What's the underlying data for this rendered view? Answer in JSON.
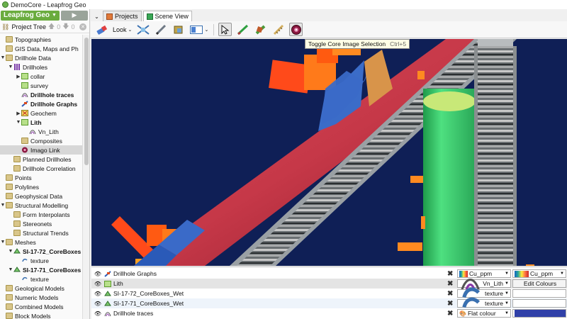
{
  "window": {
    "title": "DemoCore - Leapfrog Geo"
  },
  "app": {
    "menu_label": "Leapfrog Geo",
    "play_label": "▶"
  },
  "tree_header": {
    "label": "Project Tree",
    "count_up": "0",
    "count_down": "0"
  },
  "tree": [
    {
      "label": "Topographies",
      "arrow": "",
      "level": 0,
      "icon": "folder-icon",
      "bold": false,
      "selected": false
    },
    {
      "label": "GIS Data, Maps and Ph",
      "arrow": "",
      "level": 0,
      "icon": "folder-icon",
      "bold": false,
      "selected": false
    },
    {
      "label": "Drillhole Data",
      "arrow": "▼",
      "level": 0,
      "icon": "folder-icon",
      "bold": false,
      "selected": false
    },
    {
      "label": "Drillholes",
      "arrow": "▼",
      "level": 1,
      "icon": "drillholes-icon",
      "bold": false,
      "selected": false
    },
    {
      "label": "collar",
      "arrow": "▶",
      "level": 2,
      "icon": "table-icon",
      "bold": false,
      "selected": false
    },
    {
      "label": "survey",
      "arrow": "",
      "level": 2,
      "icon": "table-icon",
      "bold": false,
      "selected": false
    },
    {
      "label": "Drillhole traces",
      "arrow": "",
      "level": 2,
      "icon": "traces-icon",
      "bold": true,
      "selected": false
    },
    {
      "label": "Drillhole Graphs",
      "arrow": "",
      "level": 2,
      "icon": "graphs-icon",
      "bold": true,
      "selected": false
    },
    {
      "label": "Geochem",
      "arrow": "▶",
      "level": 2,
      "icon": "geochem-icon",
      "bold": false,
      "selected": false
    },
    {
      "label": "Lith",
      "arrow": "▼",
      "level": 2,
      "icon": "table-icon",
      "bold": true,
      "selected": false
    },
    {
      "label": "Vn_Lith",
      "arrow": "",
      "level": 3,
      "icon": "traces-icon",
      "bold": false,
      "selected": false
    },
    {
      "label": "Composites",
      "arrow": "",
      "level": 2,
      "icon": "folder-icon",
      "bold": false,
      "selected": false
    },
    {
      "label": "Imago Link",
      "arrow": "",
      "level": 2,
      "icon": "imago-icon",
      "bold": false,
      "selected": true
    },
    {
      "label": "Planned Drillholes",
      "arrow": "",
      "level": 1,
      "icon": "folder-icon",
      "bold": false,
      "selected": false
    },
    {
      "label": "Drillhole Correlation",
      "arrow": "",
      "level": 1,
      "icon": "folder-icon",
      "bold": false,
      "selected": false
    },
    {
      "label": "Points",
      "arrow": "",
      "level": 0,
      "icon": "folder-icon",
      "bold": false,
      "selected": false
    },
    {
      "label": "Polylines",
      "arrow": "",
      "level": 0,
      "icon": "folder-icon",
      "bold": false,
      "selected": false
    },
    {
      "label": "Geophysical Data",
      "arrow": "",
      "level": 0,
      "icon": "folder-icon",
      "bold": false,
      "selected": false
    },
    {
      "label": "Structural Modelling",
      "arrow": "▼",
      "level": 0,
      "icon": "folder-icon",
      "bold": false,
      "selected": false
    },
    {
      "label": "Form Interpolants",
      "arrow": "",
      "level": 1,
      "icon": "folder-icon",
      "bold": false,
      "selected": false
    },
    {
      "label": "Stereonets",
      "arrow": "",
      "level": 1,
      "icon": "folder-icon",
      "bold": false,
      "selected": false
    },
    {
      "label": "Structural Trends",
      "arrow": "",
      "level": 1,
      "icon": "folder-icon",
      "bold": false,
      "selected": false
    },
    {
      "label": "Meshes",
      "arrow": "▼",
      "level": 0,
      "icon": "folder-icon",
      "bold": false,
      "selected": false
    },
    {
      "label": "SI-17-72_CoreBoxes",
      "arrow": "▼",
      "level": 1,
      "icon": "mesh-icon",
      "bold": true,
      "selected": false
    },
    {
      "label": "texture",
      "arrow": "",
      "level": 2,
      "icon": "texture-icon",
      "bold": false,
      "selected": false
    },
    {
      "label": "SI-17-71_CoreBoxes",
      "arrow": "▼",
      "level": 1,
      "icon": "mesh-icon",
      "bold": true,
      "selected": false
    },
    {
      "label": "texture",
      "arrow": "",
      "level": 2,
      "icon": "texture-icon",
      "bold": false,
      "selected": false
    },
    {
      "label": "Geological Models",
      "arrow": "",
      "level": 0,
      "icon": "folder-icon",
      "bold": false,
      "selected": false
    },
    {
      "label": "Numeric Models",
      "arrow": "",
      "level": 0,
      "icon": "folder-icon",
      "bold": false,
      "selected": false
    },
    {
      "label": "Combined Models",
      "arrow": "",
      "level": 0,
      "icon": "folder-icon",
      "bold": false,
      "selected": false
    },
    {
      "label": "Block Models",
      "arrow": "",
      "level": 0,
      "icon": "folder-icon",
      "bold": false,
      "selected": false
    }
  ],
  "tabs": [
    {
      "label": "Projects",
      "active": false,
      "icon": "projects-icon"
    },
    {
      "label": "Scene View",
      "active": true,
      "icon": "scene-view-icon"
    }
  ],
  "toolbar": {
    "look_label": "Look",
    "tooltip": {
      "text": "Toggle Core Image Selection",
      "shortcut": "Ctrl+5"
    }
  },
  "layers": [
    {
      "name": "Drillhole Graphs",
      "icon": "graphs-icon",
      "style": "hl0",
      "sel1": "Cu_ppm",
      "sel1_icon": "gradient",
      "sel2": "Cu_ppm",
      "sel2_type": "gradient"
    },
    {
      "name": "Lith",
      "icon": "table-icon",
      "style": "hl",
      "sel1": "Vn_Lith",
      "sel1_icon": "traces",
      "sel2": "Edit Colours",
      "sel2_type": "button"
    },
    {
      "name": "SI-17-72_CoreBoxes_Wet",
      "icon": "mesh-icon",
      "style": "plain",
      "sel1": "texture",
      "sel1_icon": "texture",
      "sel2": "",
      "sel2_type": "blank"
    },
    {
      "name": "SI-17-71_CoreBoxes_Wet",
      "icon": "mesh-icon",
      "style": "alt",
      "sel1": "texture",
      "sel1_icon": "texture",
      "sel2": "",
      "sel2_type": "blank"
    },
    {
      "name": "Drillhole traces",
      "icon": "traces-icon",
      "style": "plain",
      "sel1": "Flat colour",
      "sel1_icon": "palette",
      "sel2": "",
      "sel2_type": "swatch",
      "swatch_color": "#3040a8"
    }
  ],
  "colors": {
    "brand": "#6aac3e",
    "scene_bg": "#0f1f56",
    "cylinder": "#c8384b",
    "green_tube": "#3cc96d"
  }
}
